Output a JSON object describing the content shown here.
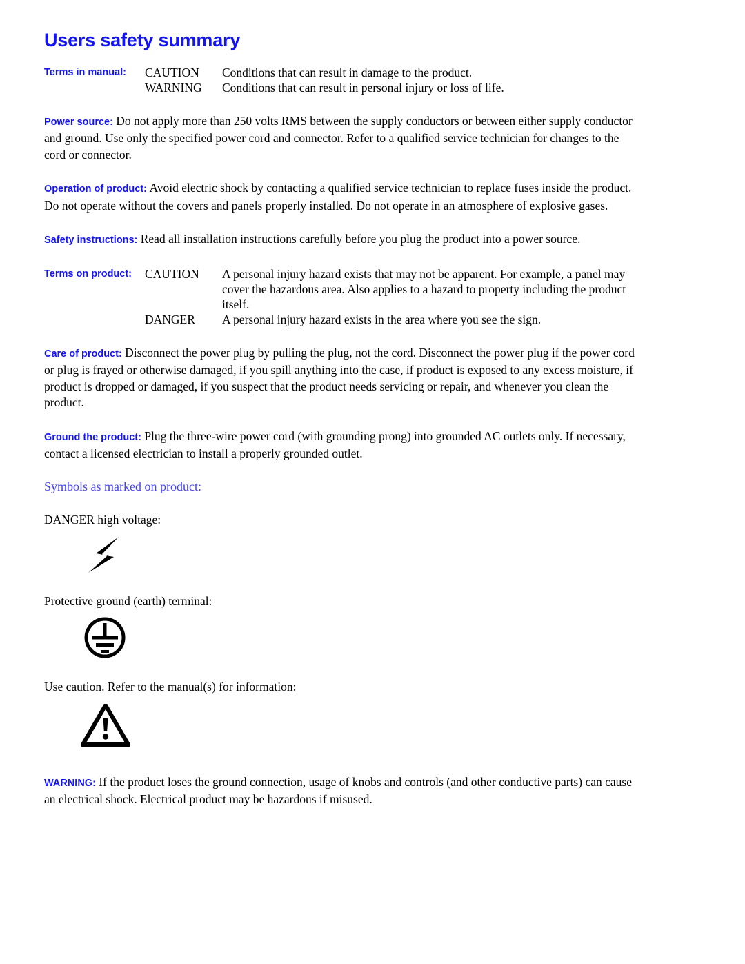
{
  "document": {
    "title": "Users safety summary",
    "title_color": "#1414f0",
    "label_color": "#1414f0",
    "symbols_heading_color": "#4242e8"
  },
  "terms_in_manual": {
    "label": "Terms in manual:",
    "rows": [
      {
        "key": "CAUTION",
        "desc": "Conditions that can result in damage to the product."
      },
      {
        "key": "WARNING",
        "desc": "Conditions that can result in personal injury or loss of life."
      }
    ]
  },
  "power_source": {
    "label": "Power source:",
    "body": "Do not apply more than 250 volts RMS between the supply conductors or between either supply conductor and ground.  Use only the specified power cord and connector.  Refer to a qualified service technician for changes to the cord or connector."
  },
  "operation_of_product": {
    "label": "Operation of product:",
    "body": "Avoid electric shock by contacting a qualified service technician to replace fuses inside the product.  Do not operate without the covers and panels properly installed.  Do not operate in an atmosphere of explosive gases."
  },
  "safety_instructions": {
    "label": "Safety instructions:",
    "body": "Read all installation instructions carefully before you plug the product into a power source."
  },
  "terms_on_product": {
    "label": "Terms on product:",
    "rows": [
      {
        "key": "CAUTION",
        "desc": "A personal injury hazard exists that may not be apparent.  For example, a panel may cover the hazardous area.  Also applies to a hazard to property including the product itself."
      },
      {
        "key": "DANGER",
        "desc": "A personal injury hazard exists in the area where you see the sign."
      }
    ]
  },
  "care_of_product": {
    "label": "Care of product:",
    "body": "Disconnect the power plug by pulling the plug, not the cord.  Disconnect the power plug if the power cord or plug is frayed or otherwise damaged, if you spill anything into the case, if product is exposed to any excess moisture, if product is dropped or damaged, if you suspect that the product needs servicing or repair, and whenever you clean the product."
  },
  "ground_the_product": {
    "label": "Ground the product:",
    "body": "Plug the three-wire power cord (with grounding prong) into grounded AC outlets only.  If necessary, contact a licensed electrician to install a properly grounded outlet."
  },
  "symbols": {
    "heading": "Symbols as marked on product:",
    "items": [
      {
        "caption": "DANGER high voltage:",
        "icon": "high-voltage-lightning-icon"
      },
      {
        "caption": "Protective ground (earth) terminal:",
        "icon": "protective-earth-ground-icon"
      },
      {
        "caption": "Use caution.  Refer to the manual(s) for information:",
        "icon": "caution-exclamation-triangle-icon"
      }
    ]
  },
  "final_warning": {
    "label": "WARNING:",
    "body": "If the product loses the ground connection, usage of knobs and controls (and other conductive parts) can cause an electrical shock.  Electrical product may be hazardous if misused."
  }
}
